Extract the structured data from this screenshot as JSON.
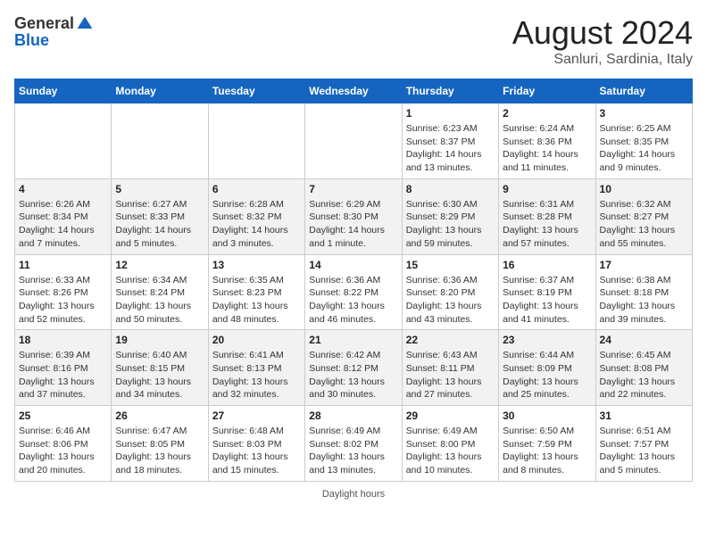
{
  "header": {
    "logo_general": "General",
    "logo_blue": "Blue",
    "title": "August 2024",
    "subtitle": "Sanluri, Sardinia, Italy"
  },
  "days_of_week": [
    "Sunday",
    "Monday",
    "Tuesday",
    "Wednesday",
    "Thursday",
    "Friday",
    "Saturday"
  ],
  "weeks": [
    [
      {
        "day": "",
        "info": ""
      },
      {
        "day": "",
        "info": ""
      },
      {
        "day": "",
        "info": ""
      },
      {
        "day": "",
        "info": ""
      },
      {
        "day": "1",
        "info": "Sunrise: 6:23 AM\nSunset: 8:37 PM\nDaylight: 14 hours and 13 minutes."
      },
      {
        "day": "2",
        "info": "Sunrise: 6:24 AM\nSunset: 8:36 PM\nDaylight: 14 hours and 11 minutes."
      },
      {
        "day": "3",
        "info": "Sunrise: 6:25 AM\nSunset: 8:35 PM\nDaylight: 14 hours and 9 minutes."
      }
    ],
    [
      {
        "day": "4",
        "info": "Sunrise: 6:26 AM\nSunset: 8:34 PM\nDaylight: 14 hours and 7 minutes."
      },
      {
        "day": "5",
        "info": "Sunrise: 6:27 AM\nSunset: 8:33 PM\nDaylight: 14 hours and 5 minutes."
      },
      {
        "day": "6",
        "info": "Sunrise: 6:28 AM\nSunset: 8:32 PM\nDaylight: 14 hours and 3 minutes."
      },
      {
        "day": "7",
        "info": "Sunrise: 6:29 AM\nSunset: 8:30 PM\nDaylight: 14 hours and 1 minute."
      },
      {
        "day": "8",
        "info": "Sunrise: 6:30 AM\nSunset: 8:29 PM\nDaylight: 13 hours and 59 minutes."
      },
      {
        "day": "9",
        "info": "Sunrise: 6:31 AM\nSunset: 8:28 PM\nDaylight: 13 hours and 57 minutes."
      },
      {
        "day": "10",
        "info": "Sunrise: 6:32 AM\nSunset: 8:27 PM\nDaylight: 13 hours and 55 minutes."
      }
    ],
    [
      {
        "day": "11",
        "info": "Sunrise: 6:33 AM\nSunset: 8:26 PM\nDaylight: 13 hours and 52 minutes."
      },
      {
        "day": "12",
        "info": "Sunrise: 6:34 AM\nSunset: 8:24 PM\nDaylight: 13 hours and 50 minutes."
      },
      {
        "day": "13",
        "info": "Sunrise: 6:35 AM\nSunset: 8:23 PM\nDaylight: 13 hours and 48 minutes."
      },
      {
        "day": "14",
        "info": "Sunrise: 6:36 AM\nSunset: 8:22 PM\nDaylight: 13 hours and 46 minutes."
      },
      {
        "day": "15",
        "info": "Sunrise: 6:36 AM\nSunset: 8:20 PM\nDaylight: 13 hours and 43 minutes."
      },
      {
        "day": "16",
        "info": "Sunrise: 6:37 AM\nSunset: 8:19 PM\nDaylight: 13 hours and 41 minutes."
      },
      {
        "day": "17",
        "info": "Sunrise: 6:38 AM\nSunset: 8:18 PM\nDaylight: 13 hours and 39 minutes."
      }
    ],
    [
      {
        "day": "18",
        "info": "Sunrise: 6:39 AM\nSunset: 8:16 PM\nDaylight: 13 hours and 37 minutes."
      },
      {
        "day": "19",
        "info": "Sunrise: 6:40 AM\nSunset: 8:15 PM\nDaylight: 13 hours and 34 minutes."
      },
      {
        "day": "20",
        "info": "Sunrise: 6:41 AM\nSunset: 8:13 PM\nDaylight: 13 hours and 32 minutes."
      },
      {
        "day": "21",
        "info": "Sunrise: 6:42 AM\nSunset: 8:12 PM\nDaylight: 13 hours and 30 minutes."
      },
      {
        "day": "22",
        "info": "Sunrise: 6:43 AM\nSunset: 8:11 PM\nDaylight: 13 hours and 27 minutes."
      },
      {
        "day": "23",
        "info": "Sunrise: 6:44 AM\nSunset: 8:09 PM\nDaylight: 13 hours and 25 minutes."
      },
      {
        "day": "24",
        "info": "Sunrise: 6:45 AM\nSunset: 8:08 PM\nDaylight: 13 hours and 22 minutes."
      }
    ],
    [
      {
        "day": "25",
        "info": "Sunrise: 6:46 AM\nSunset: 8:06 PM\nDaylight: 13 hours and 20 minutes."
      },
      {
        "day": "26",
        "info": "Sunrise: 6:47 AM\nSunset: 8:05 PM\nDaylight: 13 hours and 18 minutes."
      },
      {
        "day": "27",
        "info": "Sunrise: 6:48 AM\nSunset: 8:03 PM\nDaylight: 13 hours and 15 minutes."
      },
      {
        "day": "28",
        "info": "Sunrise: 6:49 AM\nSunset: 8:02 PM\nDaylight: 13 hours and 13 minutes."
      },
      {
        "day": "29",
        "info": "Sunrise: 6:49 AM\nSunset: 8:00 PM\nDaylight: 13 hours and 10 minutes."
      },
      {
        "day": "30",
        "info": "Sunrise: 6:50 AM\nSunset: 7:59 PM\nDaylight: 13 hours and 8 minutes."
      },
      {
        "day": "31",
        "info": "Sunrise: 6:51 AM\nSunset: 7:57 PM\nDaylight: 13 hours and 5 minutes."
      }
    ]
  ],
  "footer": "Daylight hours"
}
